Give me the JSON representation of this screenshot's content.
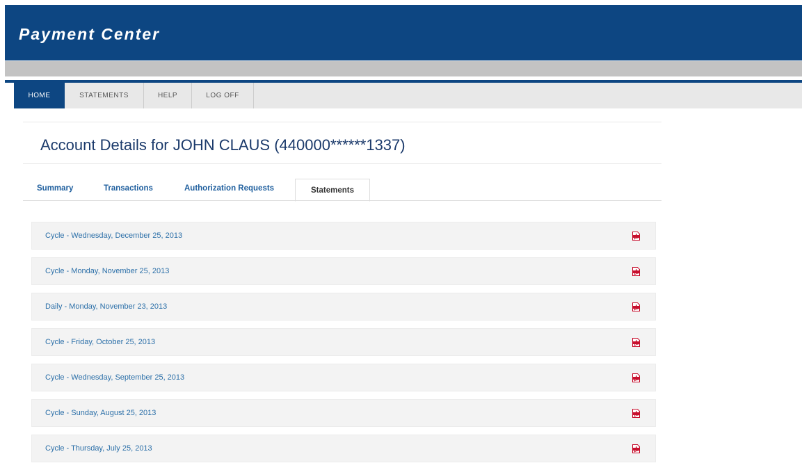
{
  "header": {
    "brand": "Payment Center"
  },
  "nav": {
    "items": [
      {
        "label": "HOME",
        "active": true
      },
      {
        "label": "STATEMENTS",
        "active": false
      },
      {
        "label": "HELP",
        "active": false
      },
      {
        "label": "LOG OFF",
        "active": false
      }
    ]
  },
  "page": {
    "title": "Account Details for JOHN CLAUS (440000******1337)"
  },
  "tabs": [
    {
      "label": "Summary"
    },
    {
      "label": "Transactions"
    },
    {
      "label": "Authorization Requests"
    },
    {
      "label": "Statements",
      "active": true
    }
  ],
  "statements": [
    {
      "label": "Cycle - Wednesday, December 25, 2013",
      "icon": "pdf-icon"
    },
    {
      "label": "Cycle - Monday, November 25, 2013",
      "icon": "pdf-icon"
    },
    {
      "label": "Daily - Monday, November 23, 2013",
      "icon": "pdf-icon"
    },
    {
      "label": "Cycle - Friday, October 25, 2013",
      "icon": "pdf-icon"
    },
    {
      "label": "Cycle - Wednesday, September 25, 2013",
      "icon": "pdf-icon"
    },
    {
      "label": "Cycle - Sunday, August 25, 2013",
      "icon": "pdf-icon"
    },
    {
      "label": "Cycle - Thursday, July 25, 2013",
      "icon": "pdf-icon"
    }
  ],
  "colors": {
    "brand_blue": "#0d4682",
    "link_blue": "#2b6fa8",
    "title_navy": "#1b3a6b",
    "pdf_red": "#c8102e"
  }
}
